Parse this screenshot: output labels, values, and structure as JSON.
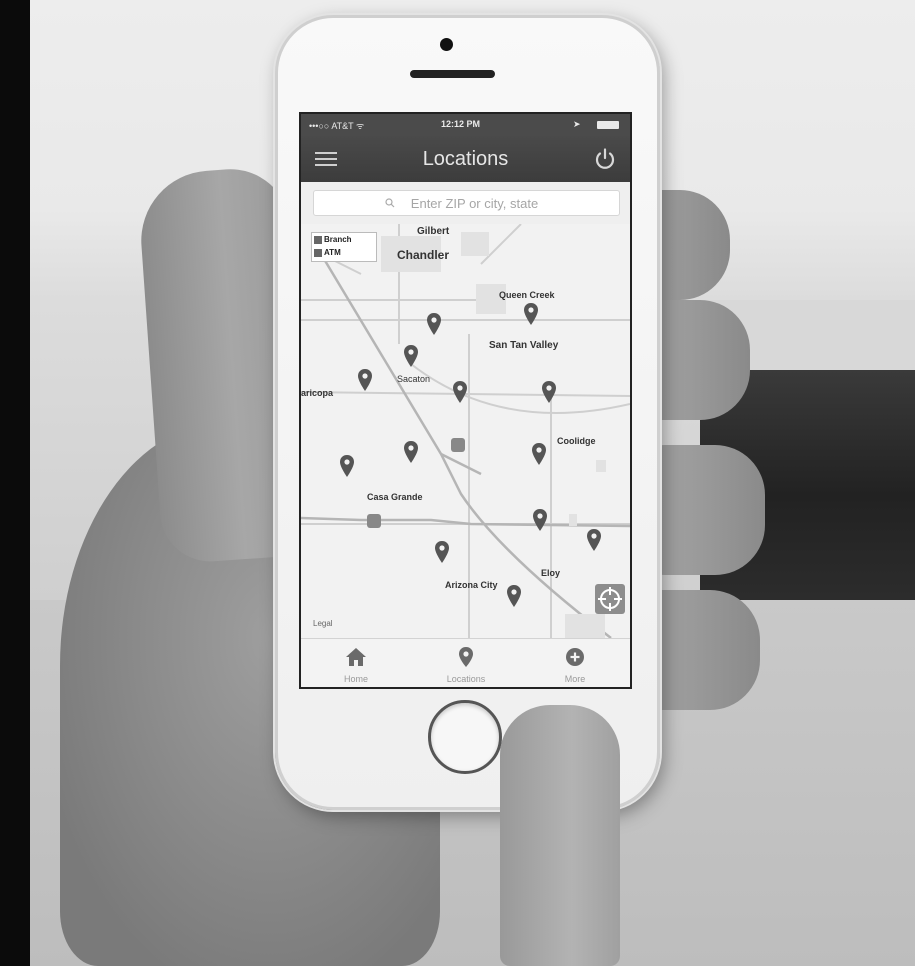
{
  "status_bar": {
    "carrier": "•••○○ AT&T ᯤ",
    "time": "12:12 PM"
  },
  "header": {
    "title": "Locations"
  },
  "search": {
    "placeholder": "Enter ZIP or city, state"
  },
  "map": {
    "legend": [
      "Branch",
      "ATM"
    ],
    "labels": [
      {
        "text": "Gilbert",
        "style": "bold"
      },
      {
        "text": "Chandler",
        "style": "big"
      },
      {
        "text": "Queen Creek",
        "style": "bold"
      },
      {
        "text": "San Tan Valley",
        "style": "bold"
      },
      {
        "text": "Sacaton",
        "style": ""
      },
      {
        "text": "aricopa",
        "style": "bold"
      },
      {
        "text": "Coolidge",
        "style": "bold"
      },
      {
        "text": "Casa Grande",
        "style": "bold"
      },
      {
        "text": "Eloy",
        "style": "bold"
      },
      {
        "text": "Arizona City",
        "style": "bold"
      }
    ],
    "legal": "Legal",
    "pins": [
      {
        "name": "map-pin-1"
      },
      {
        "name": "map-pin-2"
      },
      {
        "name": "map-pin-3"
      },
      {
        "name": "map-pin-4"
      },
      {
        "name": "map-pin-5"
      },
      {
        "name": "map-pin-6"
      },
      {
        "name": "map-pin-7"
      },
      {
        "name": "map-pin-8"
      },
      {
        "name": "map-pin-9"
      },
      {
        "name": "map-pin-10"
      },
      {
        "name": "map-pin-11"
      },
      {
        "name": "map-pin-12"
      },
      {
        "name": "map-pin-13"
      },
      {
        "name": "map-pin-14"
      }
    ]
  },
  "tabs": [
    {
      "label": "Home",
      "icon": "home-icon"
    },
    {
      "label": "Locations",
      "icon": "map-pin-icon"
    },
    {
      "label": "More",
      "icon": "plus-circle-icon"
    }
  ],
  "colors": {
    "nav_bar": "#3c3c3c",
    "pin": "#555555",
    "map_bg": "#f2f2f2"
  }
}
